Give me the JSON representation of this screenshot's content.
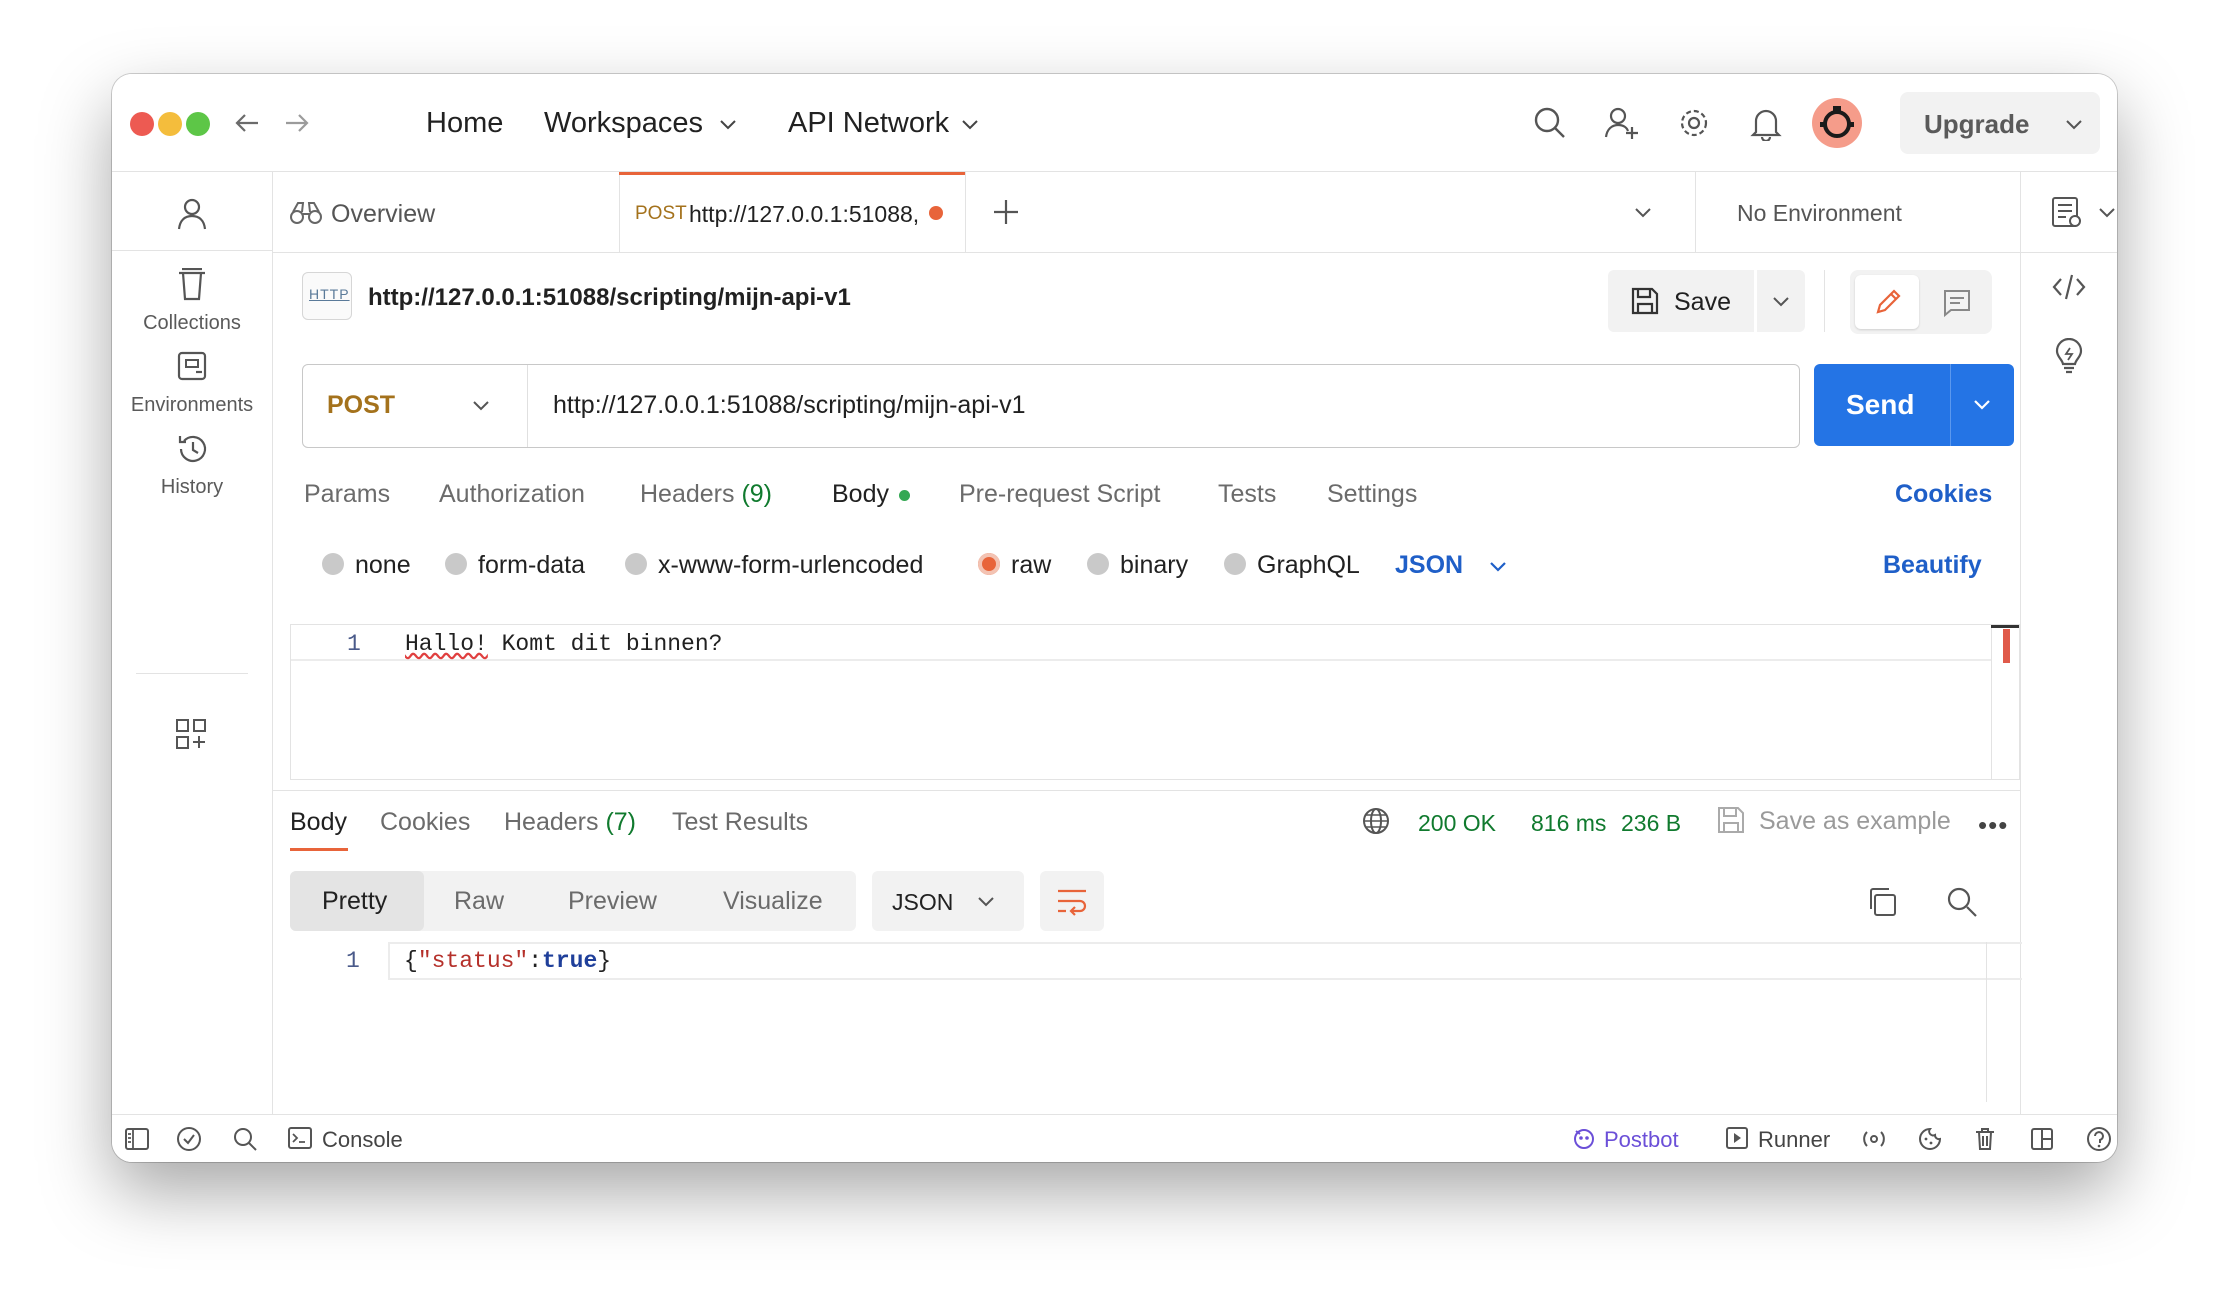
{
  "titlebar": {
    "home": "Home",
    "workspaces": "Workspaces",
    "api_network": "API Network",
    "upgrade": "Upgrade"
  },
  "sidebar": {
    "items": [
      {
        "label": "Collections",
        "icon": "trash-can-icon"
      },
      {
        "label": "Environments",
        "icon": "environment-icon"
      },
      {
        "label": "History",
        "icon": "history-icon"
      }
    ]
  },
  "tabs": {
    "overview": "Overview",
    "active_method": "POST",
    "active_url": "http://127.0.0.1:51088,",
    "environment": "No Environment"
  },
  "request": {
    "title": "http://127.0.0.1:51088/scripting/mijn-api-v1",
    "save": "Save",
    "method": "POST",
    "url": "http://127.0.0.1:51088/scripting/mijn-api-v1",
    "send": "Send",
    "tabs": [
      "Params",
      "Authorization",
      "Headers",
      "Body",
      "Pre-request Script",
      "Tests",
      "Settings"
    ],
    "headers_count": "(9)",
    "cookies": "Cookies",
    "body_types": [
      "none",
      "form-data",
      "x-www-form-urlencoded",
      "raw",
      "binary",
      "GraphQL"
    ],
    "selected_body_type": "raw",
    "format": "JSON",
    "beautify": "Beautify",
    "editor": {
      "line_number": "1",
      "word1": "Hallo!",
      "rest": " Komt dit binnen?"
    }
  },
  "response": {
    "tabs": [
      "Body",
      "Cookies",
      "Headers",
      "Test Results"
    ],
    "headers_count": "(7)",
    "status": "200 OK",
    "time": "816 ms",
    "size": "236 B",
    "save_example": "Save as example",
    "view_modes": [
      "Pretty",
      "Raw",
      "Preview",
      "Visualize"
    ],
    "format": "JSON",
    "line_number": "1",
    "code": {
      "open": "{",
      "key": "\"status\"",
      "colon": ":",
      "value": "true",
      "close": "}"
    }
  },
  "statusbar": {
    "console": "Console",
    "postbot": "Postbot",
    "runner": "Runner"
  },
  "colors": {
    "accent_orange": "#e8643a",
    "send_blue": "#2474e5",
    "link_blue": "#1f5fc8",
    "status_green": "#107a2e",
    "method_post": "#a4721c"
  }
}
